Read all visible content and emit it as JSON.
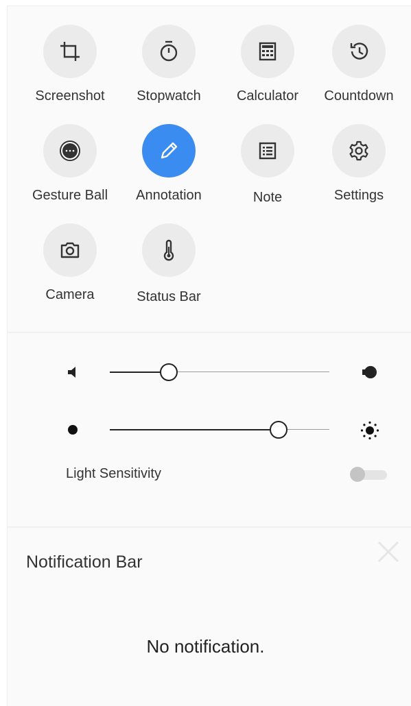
{
  "tiles": [
    {
      "label": "Screenshot",
      "icon": "crop-icon"
    },
    {
      "label": "Stopwatch",
      "icon": "stopwatch-icon"
    },
    {
      "label": "Calculator",
      "icon": "calculator-icon"
    },
    {
      "label": "Countdown",
      "icon": "countdown-icon"
    },
    {
      "label": "Gesture Ball",
      "icon": "gesture-ball-icon"
    },
    {
      "label": "Annotation",
      "icon": "pencil-icon",
      "active": true
    },
    {
      "label": "Note",
      "icon": "note-icon"
    },
    {
      "label": "Settings",
      "icon": "gear-icon"
    },
    {
      "label": "Camera",
      "icon": "camera-icon"
    },
    {
      "label": "Status Bar",
      "icon": "thermometer-icon"
    }
  ],
  "volume": {
    "level": 0.27,
    "min_icon": "volume-low-icon",
    "max_icon": "volume-high-icon"
  },
  "brightness": {
    "level": 0.77,
    "min_icon": "brightness-low-icon",
    "max_icon": "brightness-high-icon"
  },
  "light_sensitivity": {
    "label": "Light Sensitivity",
    "enabled": false
  },
  "notifications": {
    "title": "Notification Bar",
    "empty_text": "No notification."
  },
  "colors": {
    "accent": "#3b8cf0",
    "tile_bg": "#ebebeb",
    "panel_bg": "#fafafa"
  }
}
